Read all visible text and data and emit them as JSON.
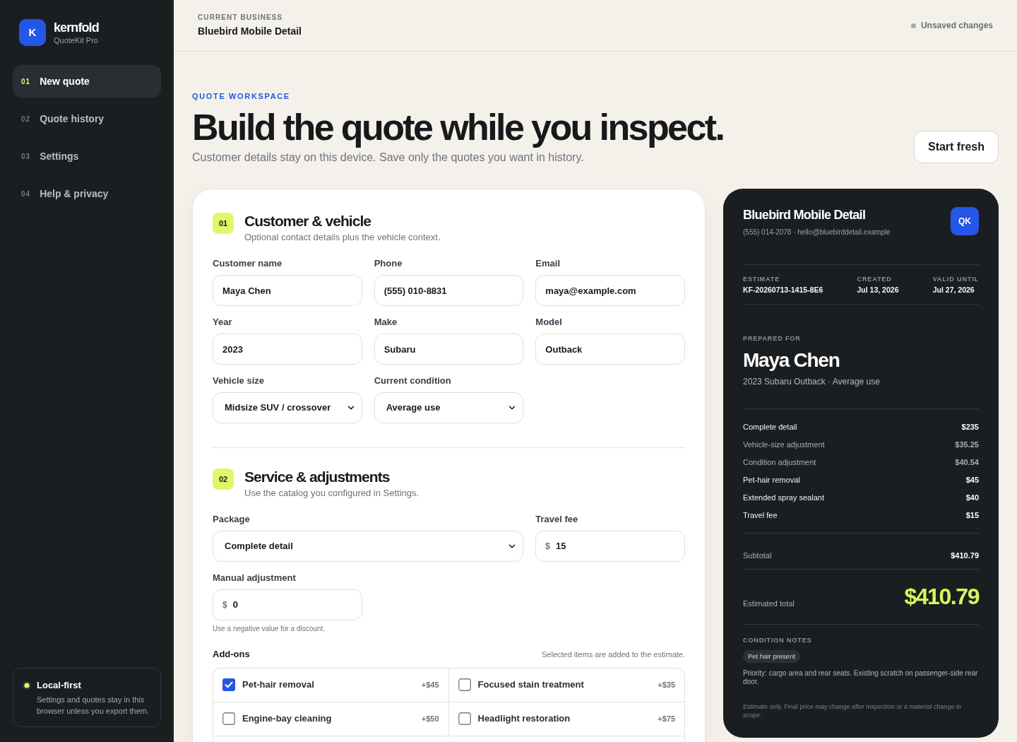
{
  "sidebar": {
    "logo_letter": "K",
    "brand": "kernfold",
    "product": "QuoteKit Pro",
    "nav": [
      {
        "number": "01",
        "label": "New quote",
        "selected": true
      },
      {
        "number": "02",
        "label": "Quote history",
        "selected": false
      },
      {
        "number": "03",
        "label": "Settings",
        "selected": false
      },
      {
        "number": "04",
        "label": "Help & privacy",
        "selected": false
      }
    ],
    "storage_note": {
      "title": "Local-first",
      "text": "Settings and quotes stay in this browser unless you export them."
    }
  },
  "header": {
    "eyebrow": "CURRENT BUSINESS",
    "business": "Bluebird Mobile Detail",
    "status": "Unsaved changes"
  },
  "hero": {
    "eyebrow": "QUOTE WORKSPACE",
    "title": "Build the quote while you inspect.",
    "subtitle": "Customer details stay on this device. Save only the quotes you want in history.",
    "button": "Start fresh"
  },
  "quote_form": {
    "sections": [
      {
        "number": "01",
        "title": "Customer & vehicle",
        "subtitle": "Optional contact details plus the vehicle context.",
        "fields": [
          {
            "label": "Customer name",
            "kind": "text",
            "value": "Maya Chen"
          },
          {
            "label": "Phone",
            "kind": "text",
            "value": "(555) 010-8831"
          },
          {
            "label": "Email",
            "kind": "text",
            "value": "maya@example.com"
          },
          {
            "label": "Year",
            "kind": "text",
            "value": "2023"
          },
          {
            "label": "Make",
            "kind": "text",
            "value": "Subaru"
          },
          {
            "label": "Model",
            "kind": "text",
            "value": "Outback"
          },
          {
            "label": "Vehicle size",
            "kind": "select",
            "value": "Midsize SUV / crossover"
          },
          {
            "label": "Current condition",
            "kind": "select",
            "value": "Average use"
          }
        ]
      },
      {
        "number": "02",
        "title": "Service & adjustments",
        "subtitle": "Use the catalog you configured in Settings.",
        "fields": [
          {
            "label": "Package",
            "kind": "select",
            "value": "Complete detail"
          },
          {
            "label": "Travel fee",
            "kind": "money",
            "prefix": "$",
            "value": "15"
          },
          {
            "label": "Manual adjustment",
            "kind": "money",
            "prefix": "$",
            "value": "0",
            "hint": "Use a negative value for a discount."
          }
        ],
        "addons": {
          "title": "Add-ons",
          "note": "Selected items are added to the estimate.",
          "items": [
            {
              "label": "Pet-hair removal",
              "price": "+$45",
              "checked": true
            },
            {
              "label": "Focused stain treatment",
              "price": "+$35",
              "checked": false
            },
            {
              "label": "Engine-bay cleaning",
              "price": "+$50",
              "checked": false
            },
            {
              "label": "Headlight restoration",
              "price": "+$75",
              "checked": false
            }
          ]
        }
      }
    ]
  },
  "estimate": {
    "business": "Bluebird Mobile Detail",
    "contact": "(555) 014-2078 · hello@bluebirddetail.example",
    "badge": "QK",
    "meta": [
      {
        "label": "ESTIMATE",
        "value": "KF-20260713-1415-8E6"
      },
      {
        "label": "CREATED",
        "value": "Jul 13, 2026"
      },
      {
        "label": "VALID UNTIL",
        "value": "Jul 27, 2026"
      }
    ],
    "prepared_for": {
      "label": "PREPARED FOR",
      "name": "Maya Chen",
      "vehicle": "2023 Subaru Outback · Average use"
    },
    "line_items": [
      {
        "label": "Complete detail",
        "amount": "$235",
        "kind": "charge"
      },
      {
        "label": "Vehicle-size adjustment",
        "amount": "$35.25",
        "kind": "adjustment"
      },
      {
        "label": "Condition adjustment",
        "amount": "$40.54",
        "kind": "adjustment"
      },
      {
        "label": "Pet-hair removal",
        "amount": "$45",
        "kind": "charge"
      },
      {
        "label": "Extended spray sealant",
        "amount": "$40",
        "kind": "charge"
      },
      {
        "label": "Travel fee",
        "amount": "$15",
        "kind": "charge"
      }
    ],
    "subtotal": {
      "label": "Subtotal",
      "amount": "$410.79"
    },
    "total": {
      "label": "Estimated total",
      "amount": "$410.79"
    },
    "notes": {
      "label": "CONDITION NOTES",
      "tags": [
        "Pet hair present"
      ],
      "text": "Priority: cargo area and rear seats. Existing scratch on passenger-side rear door.",
      "disclaimer": "Estimate only. Final price may change after inspection or a material change in scope."
    }
  }
}
